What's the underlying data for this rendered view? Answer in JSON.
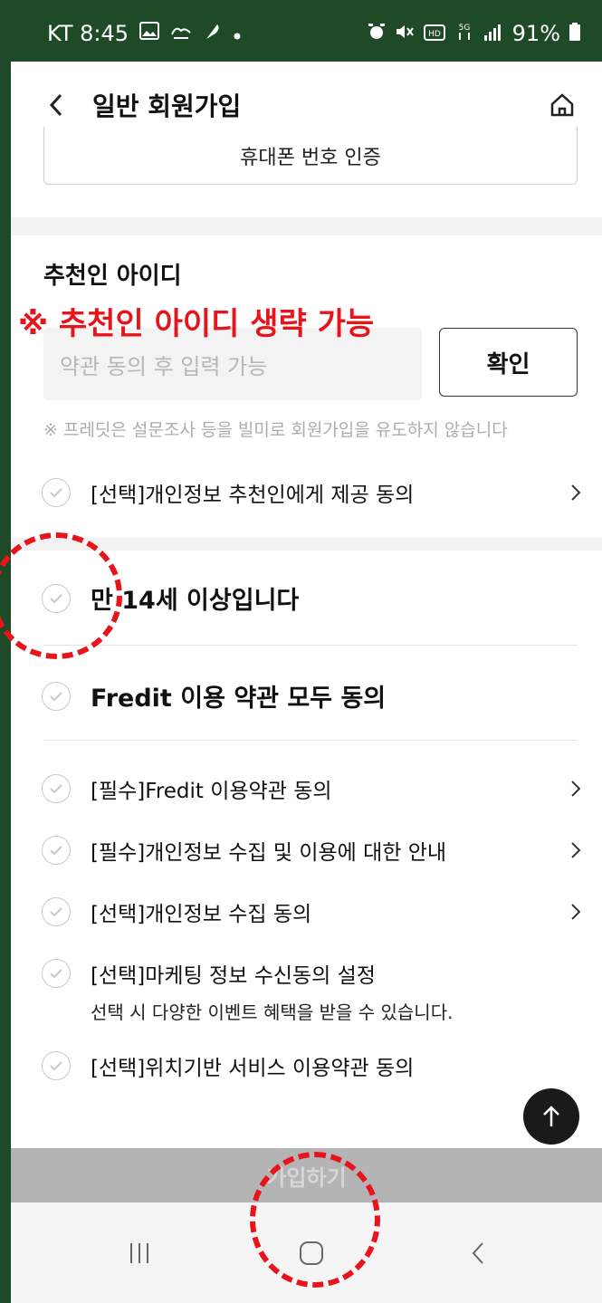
{
  "status_bar": {
    "time": "KT 8:45",
    "left_icons": [
      "gallery-icon",
      "hand-icon",
      "feather-icon",
      "dot-icon"
    ],
    "right_icons": [
      "alarm-icon",
      "mute-icon",
      "hd-icon",
      "lte-icon",
      "signal-icon"
    ],
    "battery": "91%"
  },
  "header": {
    "title": "일반 회원가입"
  },
  "phone_verify": {
    "label": "휴대폰 번호 인증"
  },
  "recommender": {
    "title": "추천인 아이디",
    "annotation": "※ 추천인 아이디 생략 가능",
    "placeholder": "약관 동의 후 입력 가능",
    "confirm_label": "확인",
    "notice": "※ 프레딧은 설문조사 등을 빌미로 회원가입을 유도하지 않습니다",
    "consent_label": "[선택]개인정보 추천인에게 제공 동의"
  },
  "age": {
    "label": "만 14세 이상입니다"
  },
  "terms": {
    "all_label": "Fredit 이용 약관 모두 동의",
    "items": [
      {
        "label": "[필수]Fredit 이용약관 동의"
      },
      {
        "label": "[필수]개인정보 수집 및 이용에 대한 안내"
      },
      {
        "label": "[선택]개인정보 수집 동의"
      },
      {
        "label": "[선택]마케팅 정보 수신동의 설정",
        "sub": "선택 시 다양한 이벤트 혜택을 받을 수 있습니다."
      },
      {
        "label": "[선택]위치기반 서비스 이용약관 동의"
      }
    ]
  },
  "signup": {
    "label": "가입하기"
  },
  "colors": {
    "status_bar": "#1f4a27",
    "annotation": "#e8141b",
    "signup_bar": "#b4b4b4"
  }
}
